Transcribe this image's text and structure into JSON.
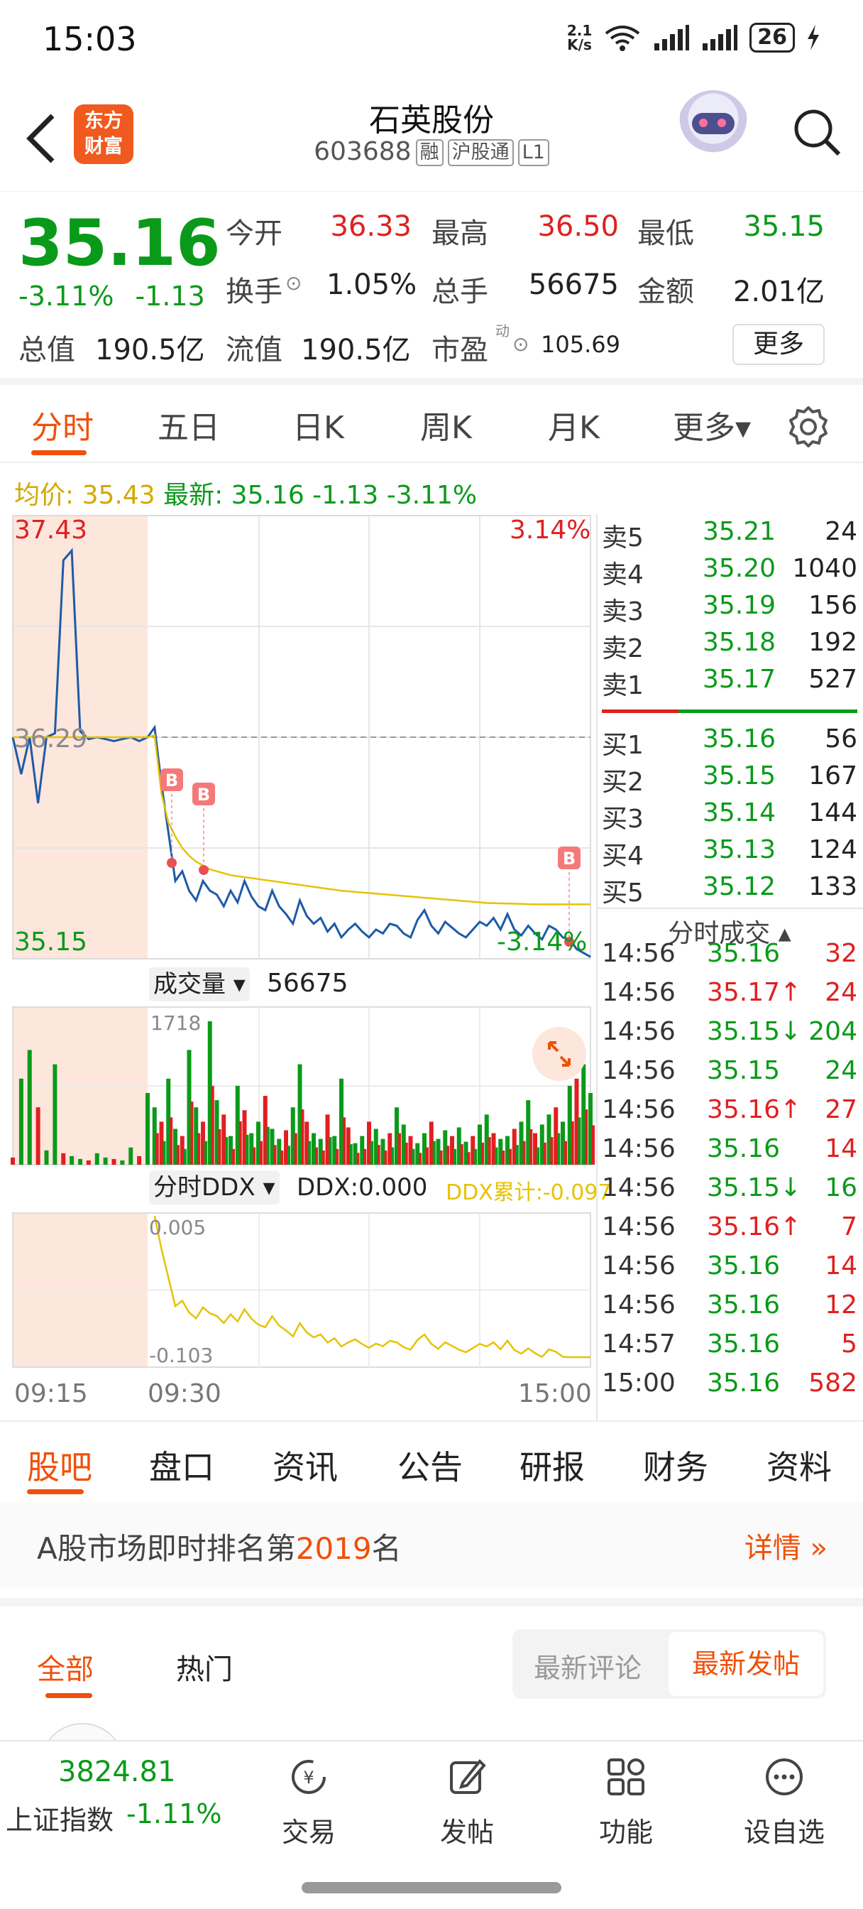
{
  "status_bar": {
    "time": "15:03",
    "net_speed": "2.1\nK/s",
    "battery": "26"
  },
  "header": {
    "logo_text": "东方\n财富",
    "stock_name": "石英股份",
    "stock_code": "603688",
    "tags": [
      "融",
      "沪股通",
      "L1"
    ]
  },
  "quote": {
    "price": "35.16",
    "change_pct": "-3.11%",
    "change": "-1.13",
    "open_label": "今开",
    "open": "36.33",
    "high_label": "最高",
    "high": "36.50",
    "low_label": "最低",
    "low": "35.15",
    "turnover_label": "换手",
    "turnover": "1.05%",
    "volume_label": "总手",
    "volume": "56675",
    "amount_label": "金额",
    "amount": "2.01亿",
    "mcap_label": "总值",
    "mcap": "190.5亿",
    "float_label": "流值",
    "float_mcap": "190.5亿",
    "pe_label": "市盈",
    "pe_sup": "动",
    "pe": "105.69",
    "more_label": "更多"
  },
  "chart_tabs": [
    "分时",
    "五日",
    "日K",
    "周K",
    "月K",
    "更多▾"
  ],
  "avg_row": {
    "avg": "均价: 35.43",
    "latest": "最新: 35.16 -1.13 -3.11%"
  },
  "chart_data": {
    "type": "line",
    "title": "",
    "y_max": "37.43",
    "y_min": "35.15",
    "y_ref": "36.29",
    "pct_max": "3.14%",
    "pct_min": "-3.14%",
    "ylim": [
      35.15,
      37.43
    ],
    "x_labels": [
      "09:15",
      "09:30",
      "15:00"
    ],
    "series": [
      {
        "values": [
          36.29,
          36.1,
          36.29,
          35.95,
          36.29,
          36.31,
          37.2,
          37.25,
          36.32,
          36.28,
          36.29,
          36.28,
          36.27,
          36.28,
          36.29,
          36.27,
          36.29,
          36.34,
          36.05,
          35.8,
          35.55,
          35.6,
          35.5,
          35.45,
          35.55,
          35.5,
          35.48,
          35.42,
          35.5,
          35.44,
          35.55,
          35.47,
          35.42,
          35.4,
          35.5,
          35.42,
          35.38,
          35.33,
          35.45,
          35.37,
          35.33,
          35.36,
          35.29,
          35.33,
          35.26,
          35.3,
          35.33,
          35.29,
          35.26,
          35.3,
          35.28,
          35.33,
          35.32,
          35.28,
          35.26,
          35.35,
          35.4,
          35.32,
          35.28,
          35.34,
          35.31,
          35.28,
          35.26,
          35.3,
          35.34,
          35.32,
          35.36,
          35.3,
          35.38,
          35.3,
          35.27,
          35.32,
          35.28,
          35.25,
          35.32,
          35.3,
          35.26,
          35.25,
          35.2,
          35.18,
          35.16
        ]
      },
      {
        "name": "均价",
        "values": [
          36.29,
          36.29,
          36.29,
          36.29,
          36.29,
          36.29,
          36.29,
          36.29,
          36.29,
          36.29,
          36.29,
          36.29,
          36.29,
          36.29,
          36.29,
          36.29,
          36.29,
          36.3,
          36.0,
          35.85,
          35.78,
          35.72,
          35.68,
          35.65,
          35.63,
          35.61,
          35.6,
          35.59,
          35.58,
          35.575,
          35.57,
          35.565,
          35.56,
          35.555,
          35.55,
          35.545,
          35.54,
          35.535,
          35.53,
          35.525,
          35.52,
          35.515,
          35.51,
          35.505,
          35.5,
          35.497,
          35.494,
          35.491,
          35.488,
          35.485,
          35.482,
          35.479,
          35.476,
          35.473,
          35.47,
          35.467,
          35.464,
          35.461,
          35.458,
          35.455,
          35.452,
          35.449,
          35.446,
          35.443,
          35.44,
          35.437,
          35.436,
          35.435,
          35.434,
          35.433,
          35.432,
          35.431,
          35.43,
          35.43,
          35.43,
          35.43,
          35.43,
          35.43,
          35.43,
          35.43,
          35.43
        ]
      }
    ],
    "buy_markers": [
      "B",
      "B",
      "B"
    ],
    "volume_label": "成交量 ▾",
    "volume_total": "56675",
    "volume_max": "1718",
    "volume_bars": [
      5,
      60,
      80,
      40,
      10,
      70,
      8,
      6,
      4,
      3,
      8,
      5,
      4,
      3,
      12,
      6,
      50,
      40,
      30,
      60,
      25,
      20,
      80,
      40,
      30,
      100,
      45,
      35,
      20,
      55,
      38,
      22,
      30,
      48,
      25,
      18,
      24,
      40,
      70,
      30,
      22,
      18,
      35,
      20,
      60,
      26,
      15,
      20,
      30,
      25,
      18,
      22,
      40,
      28,
      20,
      15,
      22,
      30,
      18,
      24,
      20,
      26,
      16,
      20,
      28,
      35,
      22,
      18,
      20,
      25,
      30,
      45,
      22,
      28,
      35,
      40,
      30,
      55,
      60,
      70,
      50
    ],
    "ddx_label": "分时DDX ▾",
    "ddx_value": "DDX:0.000",
    "ddx_cum": "DDX累计:-0.097",
    "ddx_max": "0.005",
    "ddx_min": "-0.103"
  },
  "order_book": {
    "asks": [
      {
        "label": "卖5",
        "price": "35.21",
        "vol": "24"
      },
      {
        "label": "卖4",
        "price": "35.20",
        "vol": "1040"
      },
      {
        "label": "卖3",
        "price": "35.19",
        "vol": "156"
      },
      {
        "label": "卖2",
        "price": "35.18",
        "vol": "192"
      },
      {
        "label": "卖1",
        "price": "35.17",
        "vol": "527"
      }
    ],
    "bids": [
      {
        "label": "买1",
        "price": "35.16",
        "vol": "56"
      },
      {
        "label": "买2",
        "price": "35.15",
        "vol": "167"
      },
      {
        "label": "买3",
        "price": "35.14",
        "vol": "144"
      },
      {
        "label": "买4",
        "price": "35.13",
        "vol": "124"
      },
      {
        "label": "买5",
        "price": "35.12",
        "vol": "133"
      }
    ]
  },
  "trades_title": "分时成交 ▴",
  "trades": [
    {
      "time": "14:56",
      "price": "35.16",
      "vol": "32",
      "pc": "green",
      "vc": "red"
    },
    {
      "time": "14:56",
      "price": "35.17↑",
      "vol": "24",
      "pc": "red",
      "vc": "red"
    },
    {
      "time": "14:56",
      "price": "35.15↓",
      "vol": "204",
      "pc": "green",
      "vc": "green"
    },
    {
      "time": "14:56",
      "price": "35.15",
      "vol": "24",
      "pc": "green",
      "vc": "green"
    },
    {
      "time": "14:56",
      "price": "35.16↑",
      "vol": "27",
      "pc": "red",
      "vc": "red"
    },
    {
      "time": "14:56",
      "price": "35.16",
      "vol": "14",
      "pc": "green",
      "vc": "red"
    },
    {
      "time": "14:56",
      "price": "35.15↓",
      "vol": "16",
      "pc": "green",
      "vc": "green"
    },
    {
      "time": "14:56",
      "price": "35.16↑",
      "vol": "7",
      "pc": "red",
      "vc": "red"
    },
    {
      "time": "14:56",
      "price": "35.16",
      "vol": "14",
      "pc": "green",
      "vc": "red"
    },
    {
      "time": "14:56",
      "price": "35.16",
      "vol": "12",
      "pc": "green",
      "vc": "red"
    },
    {
      "time": "14:57",
      "price": "35.16",
      "vol": "5",
      "pc": "green",
      "vc": "red"
    },
    {
      "time": "15:00",
      "price": "35.16",
      "vol": "582",
      "pc": "green",
      "vc": "red"
    }
  ],
  "info_tabs": [
    "股吧",
    "盘口",
    "资讯",
    "公告",
    "研报",
    "财务",
    "资料"
  ],
  "rank": {
    "prefix": "A股市场即时排名第",
    "rank": "2019",
    "suffix": "名",
    "detail": "详情 »"
  },
  "feed": {
    "all": "全部",
    "hot": "热门",
    "latest_comment": "最新评论",
    "latest_post": "最新发帖"
  },
  "bottom_nav": {
    "index_value": "3824.81",
    "index_name": "上证指数",
    "index_pct": "-1.11%",
    "items": [
      "交易",
      "发帖",
      "功能",
      "设自选"
    ]
  },
  "colors": {
    "accent": "#f0500a",
    "up": "#e02020",
    "down": "#0a9a1a",
    "avg_line": "#e6c300",
    "price_line": "#1e5aa8"
  }
}
